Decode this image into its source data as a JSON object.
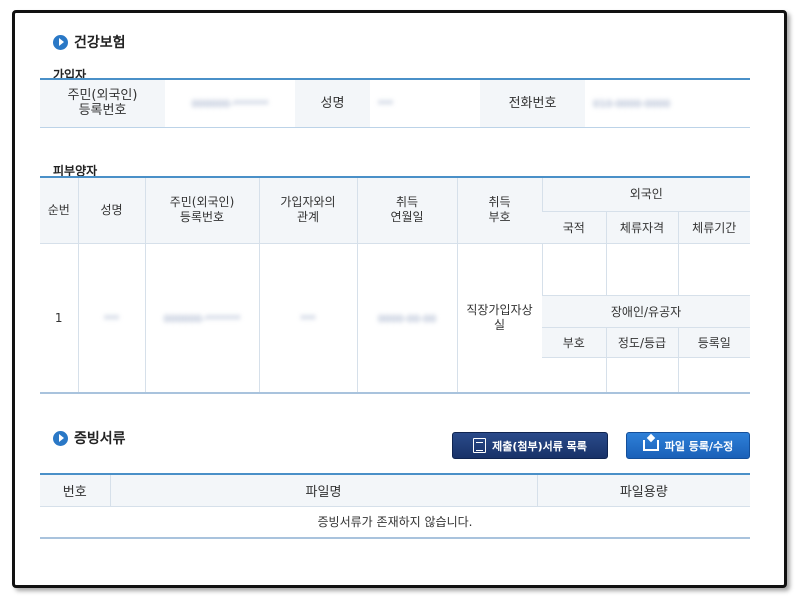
{
  "health": {
    "title": "건강보험",
    "subscriber": {
      "heading": "가입자",
      "rrn_label": "주민(외국인)\n등록번호",
      "rrn_value": "000000-*******",
      "name_label": "성명",
      "name_value": "***",
      "phone_label": "전화번호",
      "phone_value": "010-0000-0000"
    },
    "dependents": {
      "heading": "피부양자",
      "headers": {
        "seq": "순번",
        "name": "성명",
        "rrn": "주민(외국인)\n등록번호",
        "relation": "가입자와의\n관계",
        "acq_date": "취득\n연월일",
        "acq_code": "취득\n부호",
        "foreigner": "외국인",
        "nationality": "국적",
        "stay_qual": "체류자격",
        "stay_period": "체류기간",
        "disabled": "장애인/유공자",
        "dis_code": "부호",
        "dis_grade": "정도/등급",
        "dis_reg": "등록일"
      },
      "row": {
        "seq": "1",
        "name": "***",
        "rrn": "000000-*******",
        "relation": "***",
        "acq_date": "0000-00-00",
        "acq_code": "직장가입자상실"
      }
    }
  },
  "docs": {
    "title": "증빙서류",
    "list_button": "제출(첨부)서류 목록",
    "upload_button": "파일 등록/수정",
    "headers": {
      "no": "번호",
      "filename": "파일명",
      "size": "파일용량"
    },
    "empty": "증빙서류가 존재하지 않습니다."
  },
  "colors": {
    "accent": "#2a78c6",
    "border": "#4a90c8",
    "header_bg": "#f3f6f9"
  }
}
